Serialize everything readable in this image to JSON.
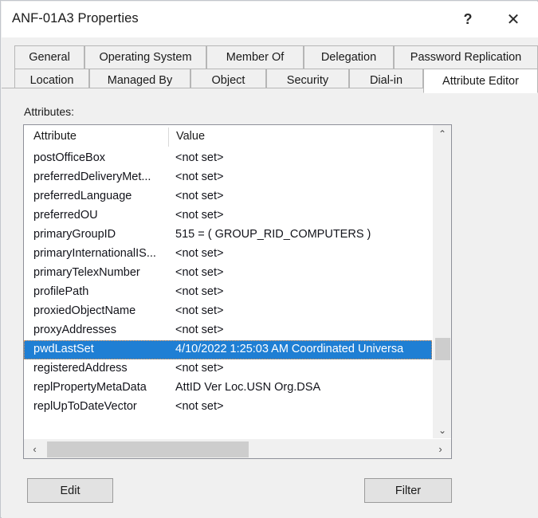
{
  "window": {
    "title": "ANF-01A3 Properties",
    "help_label": "?",
    "close_label": "✕"
  },
  "tabs": {
    "row1": [
      {
        "label": "General",
        "active": false
      },
      {
        "label": "Operating System",
        "active": false
      },
      {
        "label": "Member Of",
        "active": false
      },
      {
        "label": "Delegation",
        "active": false
      },
      {
        "label": "Password Replication",
        "active": false
      }
    ],
    "row2": [
      {
        "label": "Location",
        "active": false
      },
      {
        "label": "Managed By",
        "active": false
      },
      {
        "label": "Object",
        "active": false
      },
      {
        "label": "Security",
        "active": false
      },
      {
        "label": "Dial-in",
        "active": false
      },
      {
        "label": "Attribute Editor",
        "active": true
      }
    ]
  },
  "main": {
    "attributes_label": "Attributes:",
    "columns": {
      "attribute": "Attribute",
      "value": "Value"
    },
    "rows": [
      {
        "attribute": "postOfficeBox",
        "value": "<not set>",
        "selected": false
      },
      {
        "attribute": "preferredDeliveryMet...",
        "value": "<not set>",
        "selected": false
      },
      {
        "attribute": "preferredLanguage",
        "value": "<not set>",
        "selected": false
      },
      {
        "attribute": "preferredOU",
        "value": "<not set>",
        "selected": false
      },
      {
        "attribute": "primaryGroupID",
        "value": "515 = ( GROUP_RID_COMPUTERS )",
        "selected": false
      },
      {
        "attribute": "primaryInternationalIS...",
        "value": "<not set>",
        "selected": false
      },
      {
        "attribute": "primaryTelexNumber",
        "value": "<not set>",
        "selected": false
      },
      {
        "attribute": "profilePath",
        "value": "<not set>",
        "selected": false
      },
      {
        "attribute": "proxiedObjectName",
        "value": "<not set>",
        "selected": false
      },
      {
        "attribute": "proxyAddresses",
        "value": "<not set>",
        "selected": false
      },
      {
        "attribute": "pwdLastSet",
        "value": "4/10/2022 1:25:03 AM Coordinated Universa",
        "selected": true
      },
      {
        "attribute": "registeredAddress",
        "value": "<not set>",
        "selected": false
      },
      {
        "attribute": "replPropertyMetaData",
        "value": " AttID  Ver    Loc.USN                    Org.DSA",
        "selected": false
      },
      {
        "attribute": "replUpToDateVector",
        "value": "<not set>",
        "selected": false
      }
    ]
  },
  "scrollbars": {
    "vertical": {
      "up_arrow": "⌃",
      "down_arrow": "⌄"
    },
    "horizontal": {
      "left_arrow": "‹",
      "right_arrow": "›"
    }
  },
  "buttons": {
    "edit": "Edit",
    "filter": "Filter"
  },
  "colors": {
    "selection": "#1f7fd4",
    "focus_outline": "#e8934a",
    "window_bg": "#f0f0f0"
  }
}
